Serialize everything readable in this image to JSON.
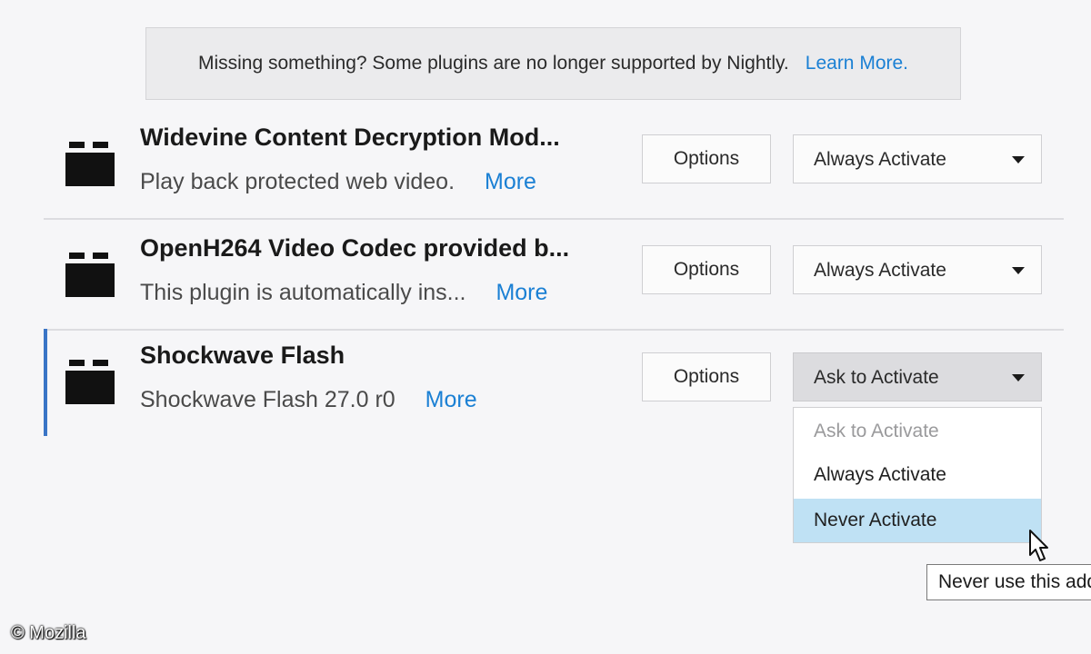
{
  "notice": {
    "message": "Missing something? Some plugins are no longer supported by Nightly.",
    "learn_more": "Learn More."
  },
  "plugins": [
    {
      "name": "Widevine Content Decryption Mod...",
      "description": "Play back protected web video.",
      "more": "More",
      "options_label": "Options",
      "state": "Always Activate"
    },
    {
      "name": "OpenH264 Video Codec provided b...",
      "description": "This plugin is automatically ins...",
      "more": "More",
      "options_label": "Options",
      "state": "Always Activate"
    },
    {
      "name": "Shockwave Flash",
      "description": "Shockwave Flash 27.0 r0",
      "more": "More",
      "options_label": "Options",
      "state": "Ask to Activate"
    }
  ],
  "dropdown": {
    "options": [
      "Ask to Activate",
      "Always Activate",
      "Never Activate"
    ],
    "highlighted": "Never Activate"
  },
  "tooltip": "Never use this add-on",
  "copyright": "© Mozilla",
  "colors": {
    "link": "#1b80d4",
    "selected_bar": "#3a75c6",
    "highlight": "#bfe1f4"
  },
  "icons": {
    "plugin": "plugin-brick-icon",
    "dropdown": "chevron-down-icon",
    "cursor": "mouse-pointer-icon"
  }
}
